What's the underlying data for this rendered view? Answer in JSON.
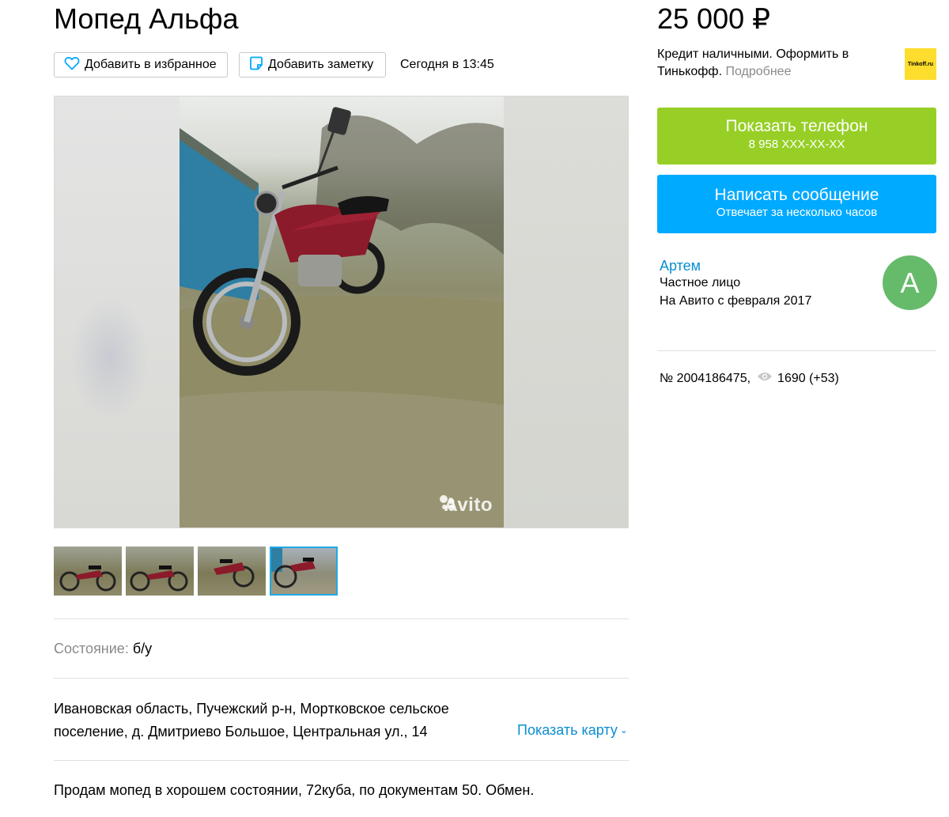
{
  "listing": {
    "title": "Мопед Альфа",
    "price": "25 000 ₽",
    "published": "Сегодня в 13:45"
  },
  "toolbar": {
    "favorite_label": "Добавить в избранное",
    "note_label": "Добавить заметку"
  },
  "gallery": {
    "watermark": "Avito",
    "thumbnail_count": 4,
    "active_thumbnail": 4
  },
  "details": {
    "condition_label": "Состояние:",
    "condition_value": "б/у",
    "address_line1": "Ивановская область, Пучежский р-н, Моpтковское сельское",
    "address_line2": "поселение, д. Дмитриево Большое, Центральная ул., 14",
    "show_map": "Показать карту",
    "description": "Продам мопед в хорошем состоянии, 72куба, по документам 50. Обмен."
  },
  "credit": {
    "text": "Кредит наличными. Оформить в Тинькофф.",
    "more": "Подробнее",
    "logo_text": "Tinkoff.ru"
  },
  "contact": {
    "phone_label": "Показать телефон",
    "phone_masked": "8 958 XXX-XX-XX",
    "message_label": "Написать сообщение",
    "message_sub": "Отвечает за несколько часов"
  },
  "seller": {
    "name": "Артем",
    "type": "Частное лицо",
    "since": "На Авито с февраля 2017",
    "avatar_letter": "А"
  },
  "meta": {
    "number": "№ 2004186475,",
    "views": "1690 (+53)"
  },
  "colors": {
    "phone_button": "#97cf26",
    "message_button": "#00aaff",
    "link": "#0a8ed0",
    "avatar": "#66bb6a",
    "tinkoff": "#ffdd2d"
  }
}
